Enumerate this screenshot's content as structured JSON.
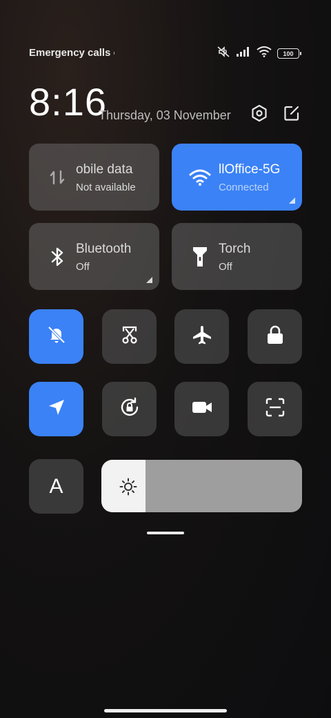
{
  "status_bar": {
    "carrier_text": "Emergency calls o",
    "battery_level": "100",
    "icons": [
      "mute-icon",
      "signal-icon",
      "wifi-icon",
      "battery-icon"
    ]
  },
  "header": {
    "time": "8:16",
    "date": "Thursday, 03 November",
    "settings_icon": "settings-icon",
    "edit_icon": "edit-icon"
  },
  "tiles": {
    "mobile_data": {
      "label": "obile data",
      "status": "Not available",
      "icon": "mobile-data-icon"
    },
    "wifi": {
      "label": "llOffice-5G",
      "status": "Connected",
      "icon": "wifi-icon"
    },
    "bluetooth": {
      "label": "Bluetooth",
      "status": "Off",
      "icon": "bluetooth-icon"
    },
    "torch": {
      "label": "Torch",
      "status": "Off",
      "icon": "torch-icon"
    }
  },
  "toggles": [
    {
      "name": "silent-mode",
      "icon": "bell-off-icon",
      "active": true
    },
    {
      "name": "screenshot",
      "icon": "screenshot-scissors-icon",
      "active": false
    },
    {
      "name": "airplane-mode",
      "icon": "airplane-icon",
      "active": false
    },
    {
      "name": "lock-screen",
      "icon": "lock-icon",
      "active": false
    },
    {
      "name": "location",
      "icon": "location-arrow-icon",
      "active": true
    },
    {
      "name": "rotation-lock",
      "icon": "rotation-lock-icon",
      "active": false
    },
    {
      "name": "screen-recorder",
      "icon": "video-camera-icon",
      "active": false
    },
    {
      "name": "scanner",
      "icon": "scan-icon",
      "active": false
    }
  ],
  "auto_brightness": {
    "label": "A"
  },
  "brightness": {
    "level": 0.22,
    "icon": "sun-icon"
  },
  "colors": {
    "accent": "#3b82f6",
    "tile": "#5a5a5a"
  }
}
